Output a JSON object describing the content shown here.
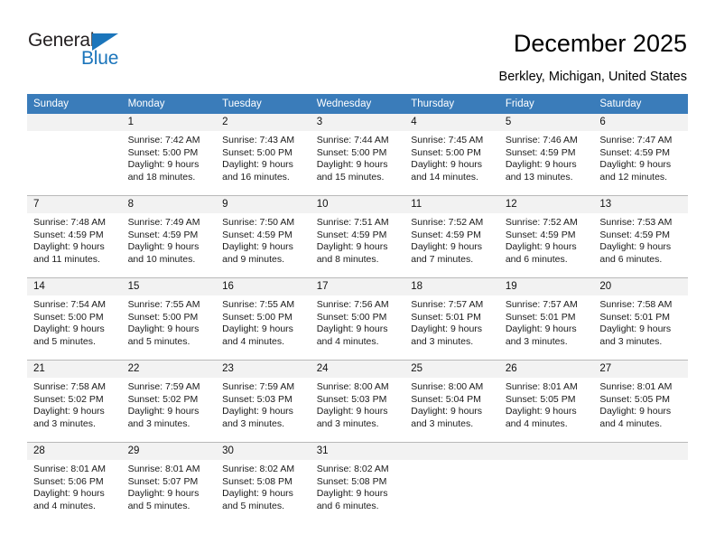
{
  "brand": {
    "name_top": "General",
    "name_bottom": "Blue",
    "accent_color": "#1b75bb",
    "triangle_icon": "triangle-icon"
  },
  "header": {
    "title": "December 2025",
    "location": "Berkley, Michigan, United States"
  },
  "calendar": {
    "header_bg": "#3a7cba",
    "daynum_bg": "#f2f2f2",
    "weekday_labels": [
      "Sunday",
      "Monday",
      "Tuesday",
      "Wednesday",
      "Thursday",
      "Friday",
      "Saturday"
    ],
    "weeks": [
      [
        {
          "day": "",
          "sunrise": "",
          "sunset": "",
          "daylight1": "",
          "daylight2": "",
          "blank": true
        },
        {
          "day": "1",
          "sunrise": "Sunrise: 7:42 AM",
          "sunset": "Sunset: 5:00 PM",
          "daylight1": "Daylight: 9 hours",
          "daylight2": "and 18 minutes."
        },
        {
          "day": "2",
          "sunrise": "Sunrise: 7:43 AM",
          "sunset": "Sunset: 5:00 PM",
          "daylight1": "Daylight: 9 hours",
          "daylight2": "and 16 minutes."
        },
        {
          "day": "3",
          "sunrise": "Sunrise: 7:44 AM",
          "sunset": "Sunset: 5:00 PM",
          "daylight1": "Daylight: 9 hours",
          "daylight2": "and 15 minutes."
        },
        {
          "day": "4",
          "sunrise": "Sunrise: 7:45 AM",
          "sunset": "Sunset: 5:00 PM",
          "daylight1": "Daylight: 9 hours",
          "daylight2": "and 14 minutes."
        },
        {
          "day": "5",
          "sunrise": "Sunrise: 7:46 AM",
          "sunset": "Sunset: 4:59 PM",
          "daylight1": "Daylight: 9 hours",
          "daylight2": "and 13 minutes."
        },
        {
          "day": "6",
          "sunrise": "Sunrise: 7:47 AM",
          "sunset": "Sunset: 4:59 PM",
          "daylight1": "Daylight: 9 hours",
          "daylight2": "and 12 minutes."
        }
      ],
      [
        {
          "day": "7",
          "sunrise": "Sunrise: 7:48 AM",
          "sunset": "Sunset: 4:59 PM",
          "daylight1": "Daylight: 9 hours",
          "daylight2": "and 11 minutes."
        },
        {
          "day": "8",
          "sunrise": "Sunrise: 7:49 AM",
          "sunset": "Sunset: 4:59 PM",
          "daylight1": "Daylight: 9 hours",
          "daylight2": "and 10 minutes."
        },
        {
          "day": "9",
          "sunrise": "Sunrise: 7:50 AM",
          "sunset": "Sunset: 4:59 PM",
          "daylight1": "Daylight: 9 hours",
          "daylight2": "and 9 minutes."
        },
        {
          "day": "10",
          "sunrise": "Sunrise: 7:51 AM",
          "sunset": "Sunset: 4:59 PM",
          "daylight1": "Daylight: 9 hours",
          "daylight2": "and 8 minutes."
        },
        {
          "day": "11",
          "sunrise": "Sunrise: 7:52 AM",
          "sunset": "Sunset: 4:59 PM",
          "daylight1": "Daylight: 9 hours",
          "daylight2": "and 7 minutes."
        },
        {
          "day": "12",
          "sunrise": "Sunrise: 7:52 AM",
          "sunset": "Sunset: 4:59 PM",
          "daylight1": "Daylight: 9 hours",
          "daylight2": "and 6 minutes."
        },
        {
          "day": "13",
          "sunrise": "Sunrise: 7:53 AM",
          "sunset": "Sunset: 4:59 PM",
          "daylight1": "Daylight: 9 hours",
          "daylight2": "and 6 minutes."
        }
      ],
      [
        {
          "day": "14",
          "sunrise": "Sunrise: 7:54 AM",
          "sunset": "Sunset: 5:00 PM",
          "daylight1": "Daylight: 9 hours",
          "daylight2": "and 5 minutes."
        },
        {
          "day": "15",
          "sunrise": "Sunrise: 7:55 AM",
          "sunset": "Sunset: 5:00 PM",
          "daylight1": "Daylight: 9 hours",
          "daylight2": "and 5 minutes."
        },
        {
          "day": "16",
          "sunrise": "Sunrise: 7:55 AM",
          "sunset": "Sunset: 5:00 PM",
          "daylight1": "Daylight: 9 hours",
          "daylight2": "and 4 minutes."
        },
        {
          "day": "17",
          "sunrise": "Sunrise: 7:56 AM",
          "sunset": "Sunset: 5:00 PM",
          "daylight1": "Daylight: 9 hours",
          "daylight2": "and 4 minutes."
        },
        {
          "day": "18",
          "sunrise": "Sunrise: 7:57 AM",
          "sunset": "Sunset: 5:01 PM",
          "daylight1": "Daylight: 9 hours",
          "daylight2": "and 3 minutes."
        },
        {
          "day": "19",
          "sunrise": "Sunrise: 7:57 AM",
          "sunset": "Sunset: 5:01 PM",
          "daylight1": "Daylight: 9 hours",
          "daylight2": "and 3 minutes."
        },
        {
          "day": "20",
          "sunrise": "Sunrise: 7:58 AM",
          "sunset": "Sunset: 5:01 PM",
          "daylight1": "Daylight: 9 hours",
          "daylight2": "and 3 minutes."
        }
      ],
      [
        {
          "day": "21",
          "sunrise": "Sunrise: 7:58 AM",
          "sunset": "Sunset: 5:02 PM",
          "daylight1": "Daylight: 9 hours",
          "daylight2": "and 3 minutes."
        },
        {
          "day": "22",
          "sunrise": "Sunrise: 7:59 AM",
          "sunset": "Sunset: 5:02 PM",
          "daylight1": "Daylight: 9 hours",
          "daylight2": "and 3 minutes."
        },
        {
          "day": "23",
          "sunrise": "Sunrise: 7:59 AM",
          "sunset": "Sunset: 5:03 PM",
          "daylight1": "Daylight: 9 hours",
          "daylight2": "and 3 minutes."
        },
        {
          "day": "24",
          "sunrise": "Sunrise: 8:00 AM",
          "sunset": "Sunset: 5:03 PM",
          "daylight1": "Daylight: 9 hours",
          "daylight2": "and 3 minutes."
        },
        {
          "day": "25",
          "sunrise": "Sunrise: 8:00 AM",
          "sunset": "Sunset: 5:04 PM",
          "daylight1": "Daylight: 9 hours",
          "daylight2": "and 3 minutes."
        },
        {
          "day": "26",
          "sunrise": "Sunrise: 8:01 AM",
          "sunset": "Sunset: 5:05 PM",
          "daylight1": "Daylight: 9 hours",
          "daylight2": "and 4 minutes."
        },
        {
          "day": "27",
          "sunrise": "Sunrise: 8:01 AM",
          "sunset": "Sunset: 5:05 PM",
          "daylight1": "Daylight: 9 hours",
          "daylight2": "and 4 minutes."
        }
      ],
      [
        {
          "day": "28",
          "sunrise": "Sunrise: 8:01 AM",
          "sunset": "Sunset: 5:06 PM",
          "daylight1": "Daylight: 9 hours",
          "daylight2": "and 4 minutes."
        },
        {
          "day": "29",
          "sunrise": "Sunrise: 8:01 AM",
          "sunset": "Sunset: 5:07 PM",
          "daylight1": "Daylight: 9 hours",
          "daylight2": "and 5 minutes."
        },
        {
          "day": "30",
          "sunrise": "Sunrise: 8:02 AM",
          "sunset": "Sunset: 5:08 PM",
          "daylight1": "Daylight: 9 hours",
          "daylight2": "and 5 minutes."
        },
        {
          "day": "31",
          "sunrise": "Sunrise: 8:02 AM",
          "sunset": "Sunset: 5:08 PM",
          "daylight1": "Daylight: 9 hours",
          "daylight2": "and 6 minutes."
        },
        {
          "day": "",
          "sunrise": "",
          "sunset": "",
          "daylight1": "",
          "daylight2": "",
          "blank": true
        },
        {
          "day": "",
          "sunrise": "",
          "sunset": "",
          "daylight1": "",
          "daylight2": "",
          "blank": true
        },
        {
          "day": "",
          "sunrise": "",
          "sunset": "",
          "daylight1": "",
          "daylight2": "",
          "blank": true
        }
      ]
    ]
  }
}
